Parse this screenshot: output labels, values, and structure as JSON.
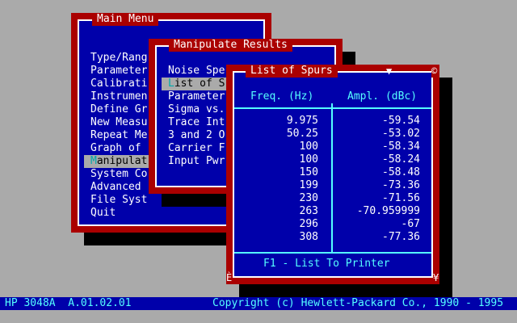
{
  "main_menu": {
    "title": "Main Menu",
    "items": [
      {
        "hot": "T",
        "rest": "ype/Rang"
      },
      {
        "hot": "P",
        "rest": "arameter"
      },
      {
        "hot": "C",
        "rest": "alibrati"
      },
      {
        "hot": "I",
        "rest": "nstrumen"
      },
      {
        "hot": "D",
        "rest": "efine Gr"
      },
      {
        "hot": "N",
        "rest": "ew Measu"
      },
      {
        "hot": "R",
        "rest": "epeat Me"
      },
      {
        "hot": "G",
        "rest": "raph of"
      },
      {
        "hot": "M",
        "rest": "anipulat"
      },
      {
        "hot": "S",
        "rest": "ystem Co"
      },
      {
        "hot": "A",
        "rest": "dvanced"
      },
      {
        "hot": "F",
        "rest": "ile Syst"
      },
      {
        "hot": "Q",
        "rest": "uit"
      }
    ]
  },
  "manipulate_menu": {
    "title": "Manipulate Results",
    "items": [
      {
        "hot": "N",
        "rest": "oise Spe"
      },
      {
        "hot": "L",
        "rest": "ist of S"
      },
      {
        "hot": "P",
        "rest": "arameter"
      },
      {
        "hot": "S",
        "rest": "igma vs."
      },
      {
        "hot": "T",
        "rest": "race Int"
      },
      {
        "hot": "3",
        "rest": " and 2 O"
      },
      {
        "hot": "C",
        "rest": "arrier F"
      },
      {
        "hot": "I",
        "rest": "nput Pwr"
      }
    ]
  },
  "spurs_window": {
    "title": "List of Spurs",
    "scroll_down_glyph": "▼",
    "close_glyph": "©",
    "corner_left_glyph": "È",
    "corner_right_glyph": "¥",
    "col_freq": "Freq. (Hz)",
    "col_ampl": "Ampl. (dBc)",
    "rows": [
      {
        "freq": "9.975",
        "ampl": "-59.54"
      },
      {
        "freq": "50.25",
        "ampl": "-53.02"
      },
      {
        "freq": "100",
        "ampl": "-58.34"
      },
      {
        "freq": "100",
        "ampl": "-58.24"
      },
      {
        "freq": "150",
        "ampl": "-58.48"
      },
      {
        "freq": "199",
        "ampl": "-73.36"
      },
      {
        "freq": "230",
        "ampl": "-71.56"
      },
      {
        "freq": "263",
        "ampl": "-70.959999"
      },
      {
        "freq": "296",
        "ampl": "-67"
      },
      {
        "freq": "308",
        "ampl": "-77.36"
      }
    ],
    "footer": "F1 - List To Printer"
  },
  "statusbar": {
    "left": "HP 3048A  A.01.02.01",
    "right": "Copyright (c) Hewlett-Packard Co., 1990 - 1995"
  },
  "colors": {
    "desktop": "#aaaaaa",
    "window_frame": "#aa0000",
    "window_bg": "#0000aa",
    "accent_cyan": "#55ffff",
    "selection": "#aaaaaa"
  }
}
